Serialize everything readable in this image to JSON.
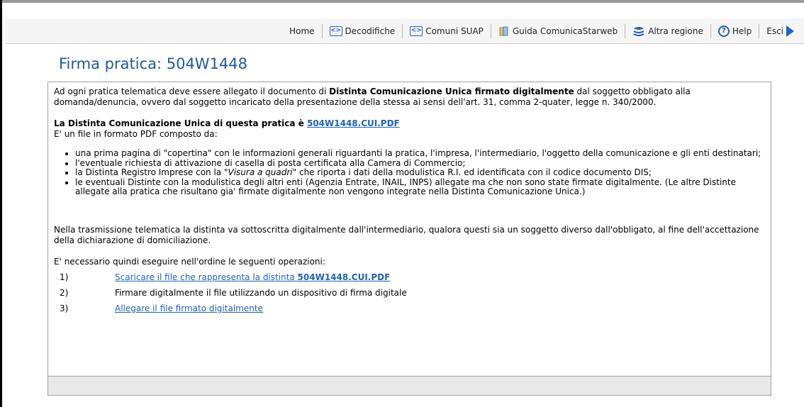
{
  "toolbar": {
    "home": "Home",
    "decodifiche": "Decodifiche",
    "comuni_suap": "Comuni SUAP",
    "guida": "Guida ComunicaStarweb",
    "altra_regione": "Altra regione",
    "help": "Help",
    "esci": "Esci",
    "icons": [
      "code-icon",
      "code-icon",
      "book-icon",
      "layers-icon",
      "help-icon",
      "exit-arrow-icon"
    ]
  },
  "page_title": "Firma pratica: 504W1448",
  "intro": {
    "part1": "Ad ogni pratica telematica deve essere allegato il documento di ",
    "bold": "Distinta Comunicazione Unica firmato digitalmente",
    "part2": " dal soggetto obbligato alla domanda/denuncia, ovvero dal soggetto incaricato della presentazione della stessa ai sensi dell'art. 31, comma 2-quater, legge n. 340/2000."
  },
  "distinta": {
    "label": "La Distinta Comunicazione Unica di questa pratica è ",
    "link": "504W1448.CUI.PDF",
    "desc": "E' un file in formato PDF composto da:"
  },
  "bullets": {
    "b1": "una prima pagina di \"copertina\" con le informazioni generali riguardanti la pratica, l'impresa, l'intermediario, l'oggetto della comunicazione e gli enti destinatari;",
    "b2": "l'eventuale richiesta di attivazione di casella di posta certificata alla Camera di Commercio;",
    "b3_pre": "la Distinta Registro Imprese con la ",
    "b3_italic": "\"Visura a quadri\"",
    "b3_post": " che riporta i dati della modulistica R.I. ed identificata con il codice documento DIS;",
    "b4": "le eventuali Distinte con la modulistica degli altri enti (Agenzia Entrate, INAIL, INPS) allegate ma che non sono state firmate digitalmente. (Le altre Distinte allegate alla pratica che risultano gia' firmate digitalmente non vengono integrate nella Distinta Comunicazione Unica.)"
  },
  "transmission_note": "Nella trasmissione telematica la distinta va sottoscritta digitalmente dall'intermediario, qualora questi sia un soggetto diverso dall'obbligato, al fine dell'accettazione della dichiarazione di domiciliazione.",
  "steps_intro": "E' necessario quindi eseguire nell'ordine le seguenti operazioni:",
  "steps": {
    "s1_num": "1)",
    "s1_text": "Scaricare il file che rappresenta la distinta ",
    "s1_bold": "504W1448.CUI.PDF",
    "s2_num": "2)",
    "s2_text": "Firmare digitalmente il file utilizzando un dispositivo di firma digitale",
    "s3_num": "3)",
    "s3_text": "Allegare il file firmato digitalmente"
  },
  "colors": {
    "title": "#1e5a9c",
    "link": "#1f62b5",
    "toolbar_bg": "#f5f5f5",
    "footer_bg": "#e9e9e9"
  }
}
